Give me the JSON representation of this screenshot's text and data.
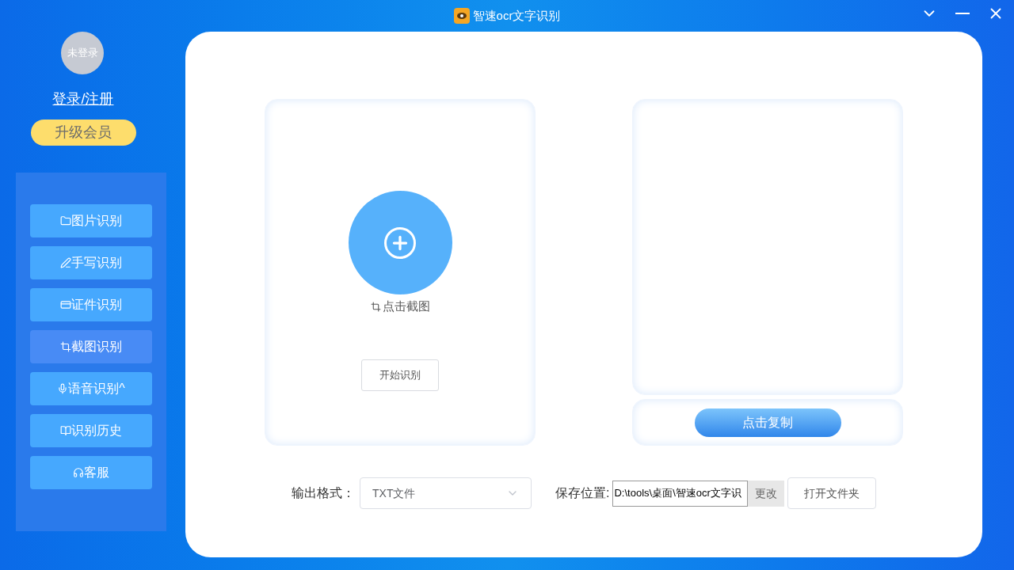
{
  "window": {
    "title": "智速ocr文字识别"
  },
  "user": {
    "avatar_text": "未登录",
    "login_link": "登录/注册",
    "upgrade_button": "升级会员"
  },
  "nav": [
    {
      "kind": "image",
      "label": "图片识别",
      "selected": false
    },
    {
      "kind": "handwriting",
      "label": "手写识别",
      "selected": false
    },
    {
      "kind": "card",
      "label": "证件识别",
      "selected": false
    },
    {
      "kind": "crop",
      "label": "截图识别",
      "selected": true
    },
    {
      "kind": "voice",
      "label": "语音识别^",
      "selected": false
    },
    {
      "kind": "history",
      "label": "识别历史",
      "selected": false
    },
    {
      "kind": "service",
      "label": "客服",
      "selected": false
    }
  ],
  "input_panel": {
    "capture_label": "点击截图",
    "start_button": "开始识别"
  },
  "output_panel": {
    "copy_button": "点击复制"
  },
  "footer": {
    "format_label": "输出格式：",
    "format_value": "TXT文件",
    "save_label": "保存位置:",
    "save_path": "D:\\tools\\桌面\\智速ocr文字识",
    "change_button": "更改",
    "open_folder_button": "打开文件夹"
  }
}
